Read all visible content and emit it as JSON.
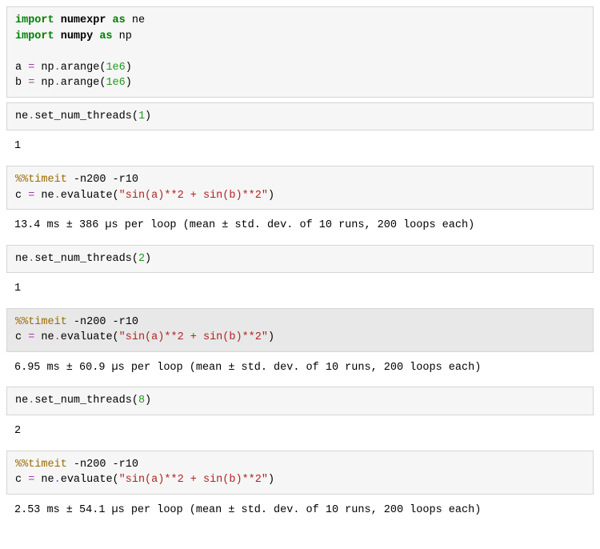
{
  "cells": [
    {
      "lines": [
        {
          "tokens": [
            {
              "t": "import ",
              "c": "tok-keyword"
            },
            {
              "t": "numexpr",
              "c": "tok-module"
            },
            {
              "t": " as ",
              "c": "tok-keyword"
            },
            {
              "t": "ne",
              "c": ""
            }
          ]
        },
        {
          "tokens": [
            {
              "t": "import ",
              "c": "tok-keyword"
            },
            {
              "t": "numpy",
              "c": "tok-module"
            },
            {
              "t": " as ",
              "c": "tok-keyword"
            },
            {
              "t": "np",
              "c": ""
            }
          ]
        },
        {
          "tokens": [
            {
              "t": " ",
              "c": ""
            }
          ]
        },
        {
          "tokens": [
            {
              "t": "a ",
              "c": ""
            },
            {
              "t": "=",
              "c": "tok-op"
            },
            {
              "t": " np",
              "c": ""
            },
            {
              "t": ".",
              "c": "tok-op"
            },
            {
              "t": "arange(",
              "c": ""
            },
            {
              "t": "1e6",
              "c": "tok-num"
            },
            {
              "t": ")",
              "c": ""
            }
          ]
        },
        {
          "tokens": [
            {
              "t": "b ",
              "c": ""
            },
            {
              "t": "=",
              "c": "tok-op"
            },
            {
              "t": " np",
              "c": ""
            },
            {
              "t": ".",
              "c": "tok-op"
            },
            {
              "t": "arange(",
              "c": ""
            },
            {
              "t": "1e6",
              "c": "tok-num"
            },
            {
              "t": ")",
              "c": ""
            }
          ]
        }
      ],
      "output": null,
      "selected": false
    },
    {
      "lines": [
        {
          "tokens": [
            {
              "t": "ne",
              "c": ""
            },
            {
              "t": ".",
              "c": "tok-op"
            },
            {
              "t": "set_num_threads(",
              "c": ""
            },
            {
              "t": "1",
              "c": "tok-num"
            },
            {
              "t": ")",
              "c": ""
            }
          ]
        }
      ],
      "output": "1",
      "selected": false
    },
    {
      "lines": [
        {
          "tokens": [
            {
              "t": "%%timeit",
              "c": "tok-magic"
            },
            {
              "t": " -n200 -r10",
              "c": ""
            }
          ]
        },
        {
          "tokens": [
            {
              "t": "c ",
              "c": ""
            },
            {
              "t": "=",
              "c": "tok-op"
            },
            {
              "t": " ne",
              "c": ""
            },
            {
              "t": ".",
              "c": "tok-op"
            },
            {
              "t": "evaluate(",
              "c": ""
            },
            {
              "t": "\"sin(a)**2 + sin(b)**2\"",
              "c": "tok-string"
            },
            {
              "t": ")",
              "c": ""
            }
          ]
        }
      ],
      "output": "13.4 ms ± 386 µs per loop (mean ± std. dev. of 10 runs, 200 loops each)",
      "selected": false
    },
    {
      "lines": [
        {
          "tokens": [
            {
              "t": "ne",
              "c": ""
            },
            {
              "t": ".",
              "c": "tok-op"
            },
            {
              "t": "set_num_threads(",
              "c": ""
            },
            {
              "t": "2",
              "c": "tok-num"
            },
            {
              "t": ")",
              "c": ""
            }
          ]
        }
      ],
      "output": "1",
      "selected": false
    },
    {
      "lines": [
        {
          "tokens": [
            {
              "t": "%%timeit",
              "c": "tok-magic"
            },
            {
              "t": " -n200 -r10",
              "c": ""
            }
          ]
        },
        {
          "tokens": [
            {
              "t": "c ",
              "c": ""
            },
            {
              "t": "=",
              "c": "tok-op"
            },
            {
              "t": " ne",
              "c": ""
            },
            {
              "t": ".",
              "c": "tok-op"
            },
            {
              "t": "evaluate(",
              "c": ""
            },
            {
              "t": "\"sin(a)**2 + sin(b)**2\"",
              "c": "tok-string"
            },
            {
              "t": ")",
              "c": ""
            }
          ]
        }
      ],
      "output": "6.95 ms ± 60.9 µs per loop (mean ± std. dev. of 10 runs, 200 loops each)",
      "selected": true
    },
    {
      "lines": [
        {
          "tokens": [
            {
              "t": "ne",
              "c": ""
            },
            {
              "t": ".",
              "c": "tok-op"
            },
            {
              "t": "set_num_threads(",
              "c": ""
            },
            {
              "t": "8",
              "c": "tok-num"
            },
            {
              "t": ")",
              "c": ""
            }
          ]
        }
      ],
      "output": "2",
      "selected": false
    },
    {
      "lines": [
        {
          "tokens": [
            {
              "t": "%%timeit",
              "c": "tok-magic"
            },
            {
              "t": " -n200 -r10",
              "c": ""
            }
          ]
        },
        {
          "tokens": [
            {
              "t": "c ",
              "c": ""
            },
            {
              "t": "=",
              "c": "tok-op"
            },
            {
              "t": " ne",
              "c": ""
            },
            {
              "t": ".",
              "c": "tok-op"
            },
            {
              "t": "evaluate(",
              "c": ""
            },
            {
              "t": "\"sin(a)**2 + sin(b)**2\"",
              "c": "tok-string"
            },
            {
              "t": ")",
              "c": ""
            }
          ]
        }
      ],
      "output": "2.53 ms ± 54.1 µs per loop (mean ± std. dev. of 10 runs, 200 loops each)",
      "selected": false
    }
  ]
}
